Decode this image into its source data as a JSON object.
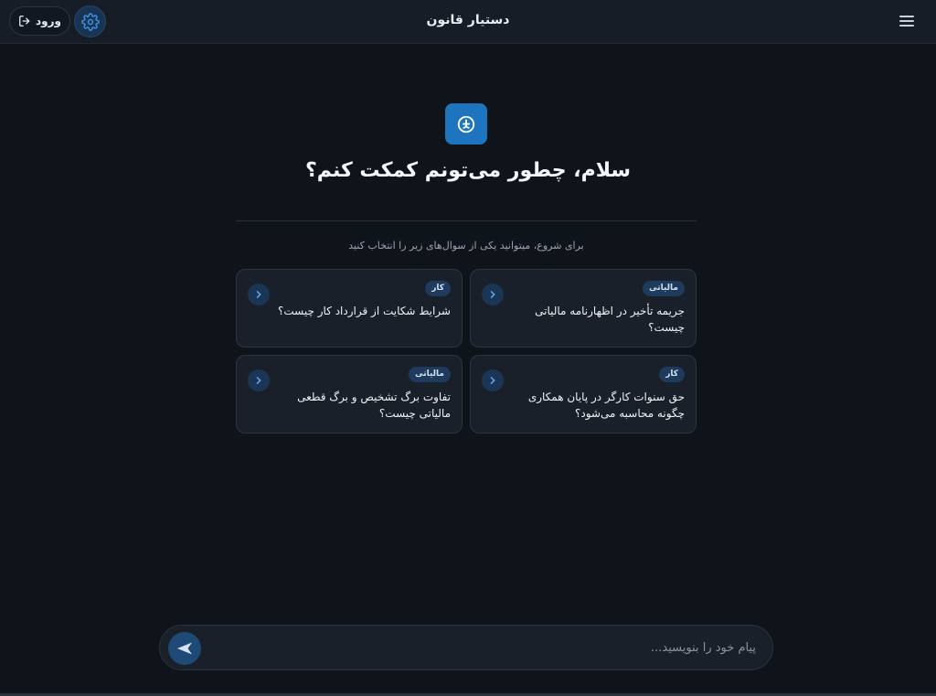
{
  "header": {
    "title": "دستیار قانون",
    "login_label": "ورود",
    "menu_icon": "menu-icon",
    "settings_icon": "gear-icon",
    "login_icon": "sign-in-icon"
  },
  "hero": {
    "logo_icon": "law-assistant-logo-icon",
    "greeting": "سلام، چطور می‌تونم کمکت کنم؟",
    "hint": "برای شروع، میتوانید یکی از سوال‌های زیر را انتخاب کنید"
  },
  "suggestions": [
    {
      "tag": "مالیاتی",
      "text": "جریمه تأخیر در اظهارنامه مالیاتی چیست؟"
    },
    {
      "tag": "کار",
      "text": "شرایط شکایت از قرارداد کار چیست؟"
    },
    {
      "tag": "کار",
      "text": "حق سنوات کارگر در پایان همکاری چگونه محاسبه می‌شود؟"
    },
    {
      "tag": "مالیاتی",
      "text": "تفاوت برگ تشخیص و برگ قطعی مالیاتی چیست؟"
    }
  ],
  "composer": {
    "placeholder": "پیام خود را بنویسید...",
    "send_icon": "send-icon"
  },
  "colors": {
    "background": "#0f141b",
    "header": "#171d27",
    "card": "#1a202a",
    "accent": "#1f74c0",
    "tag": "#1e3a5c"
  }
}
